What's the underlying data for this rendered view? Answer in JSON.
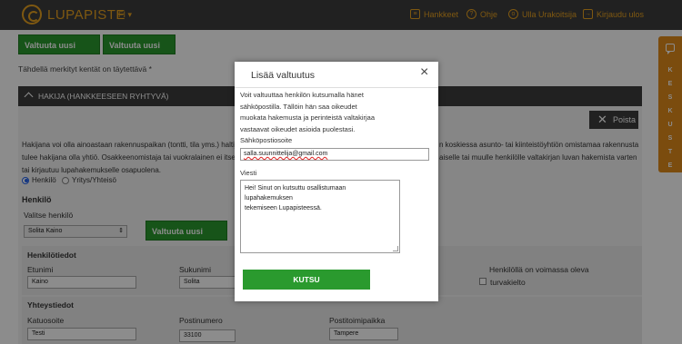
{
  "header": {
    "brand": "LUPAPISTE",
    "lang": "FI",
    "nav": [
      {
        "label": "Hankkeet",
        "icon": "document-icon"
      },
      {
        "label": "Ohje",
        "icon": "help-icon"
      },
      {
        "label": "Ulla Urakoitsija",
        "icon": "user-icon"
      },
      {
        "label": "Kirjaudu ulos",
        "icon": "logout-icon"
      }
    ]
  },
  "toolbar": {
    "authorize_person": "Valtuuta uusi henkilö",
    "authorize_company": "Valtuuta uusi yritys"
  },
  "required_note": "Tähdellä merkityt kentät on täytettävä *",
  "section": {
    "title": "HAKIJA (HANKKEESEEN RYHTYVÄ)",
    "delete": "Poista",
    "para_left_1": "Hakijana voi olla ainoastaan rakennuspaikan (tontti, tila yms.) haltija",
    "para_left_2": "tulee hakijana olla yhtiö. Osakkeenomistaja tai vuokralainen ei itsenä",
    "para_left_3": "tai kirjautuu lupahakemukselle osapuolena.",
    "para_right_1": "n koskiessa asunto- tai kiinteistöyhtiön omistamaa rakennusta",
    "para_right_2": "aiselle tai muulle henkilölle valtakirjan luvan hakemista varten",
    "radio_person": "Henkilö",
    "radio_company": "Yritys/Yhteisö",
    "person_heading": "Henkilö",
    "choose_person": "Valitse henkilö",
    "chosen_person": "Solita Kaino",
    "authorize_person": "Valtuuta uusi henkilö",
    "person_info_heading": "Henkilötiedot",
    "firstname_label": "Etunimi",
    "firstname_value": "Kaino",
    "lastname_label": "Sukunimi",
    "lastname_value": "Solita",
    "ban_label_1": "Henkilöllä on voimassa oleva",
    "ban_label_2": "turvakielto",
    "contact_heading": "Yhteystiedot",
    "street_label": "Katuosoite",
    "street_value": "Testi",
    "zip_label": "Postinumero",
    "zip_value": "33100",
    "city_label": "Postitoimipaikka",
    "city_value": "Tampere"
  },
  "feedback": {
    "letters": [
      "K",
      "E",
      "S",
      "K",
      "U",
      "S",
      "T",
      "E",
      "L",
      "U"
    ]
  },
  "modal": {
    "title": "Lisää valtuutus",
    "close": "×",
    "intro_1": "Voit valtuuttaa henkilön kutsumalla hänet",
    "intro_2": "sähköpostilla. Tällöin hän saa oikeudet",
    "intro_3": "muokata hakemusta ja perinteistä valtakirjaa",
    "intro_4": "vastaavat oikeudet asioida puolestasi.",
    "email_label": "Sähköpostiosoite",
    "email_value": "salla.suunnittelija@gmail.com",
    "message_label": "Viesti",
    "message_value_1": "Hei! Sinut on kutsuttu osallistumaan lupahakemuksen",
    "message_value_2": "tekemiseen Lupapisteessä.",
    "submit": "KUTSU"
  },
  "colors": {
    "header_bg": "#3c3c3c",
    "brand_accent": "#e6a020",
    "primary_green": "#2a9a2e",
    "feedback_orange": "#e08a1a"
  }
}
